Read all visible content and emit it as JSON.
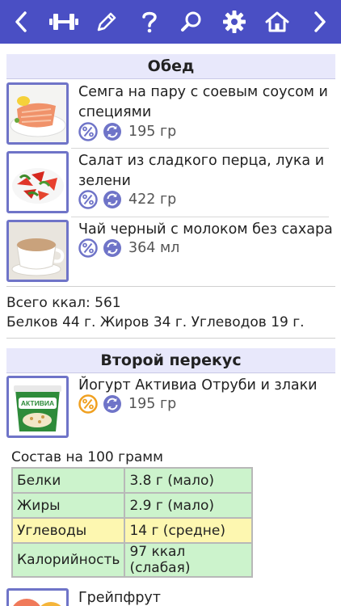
{
  "toolbar": {
    "buttons": [
      "back",
      "workout",
      "edit",
      "help",
      "search",
      "settings",
      "home",
      "forward"
    ],
    "color": "#4a4fc4"
  },
  "sections": [
    {
      "title": "Обед",
      "items": [
        {
          "title": "Семга на пару с соевым соусом и специями",
          "amount": "195 гр",
          "image": "salmon"
        },
        {
          "title": "Салат из сладкого перца, лука и зелени",
          "amount": "422 гр",
          "image": "pepper-salad"
        },
        {
          "title": "Чай черный с молоком без сахара",
          "amount": "364 мл",
          "image": "tea-with-milk"
        }
      ],
      "total_kcal": "Всего ккал: 561",
      "macros": "Белков 44 г. Жиров 34 г. Углеводов 19 г."
    },
    {
      "title": "Второй перекус",
      "items": [
        {
          "title": "Йогурт Активиа Отруби и злаки",
          "amount": "195 гр",
          "image": "yogurt",
          "label": "АКТИВИА"
        }
      ],
      "composition": {
        "title": "Состав на 100 грамм",
        "rows": [
          {
            "name": "Белки",
            "value": "3.8 г (мало)",
            "level": "green"
          },
          {
            "name": "Жиры",
            "value": "2.9 г (мало)",
            "level": "green"
          },
          {
            "name": "Углеводы",
            "value": "14 г (средне)",
            "level": "yellow"
          },
          {
            "name": "Калорийность",
            "value": "97 ккал (слабая)",
            "level": "green"
          }
        ]
      },
      "next_item": {
        "title": "Грейпфрут",
        "image": "grapefruit"
      }
    }
  ],
  "colors": {
    "green": "#ccf3cc",
    "yellow": "#fdf7b0",
    "percent_blue": "#6f74c8",
    "percent_orange": "#f0a020"
  }
}
